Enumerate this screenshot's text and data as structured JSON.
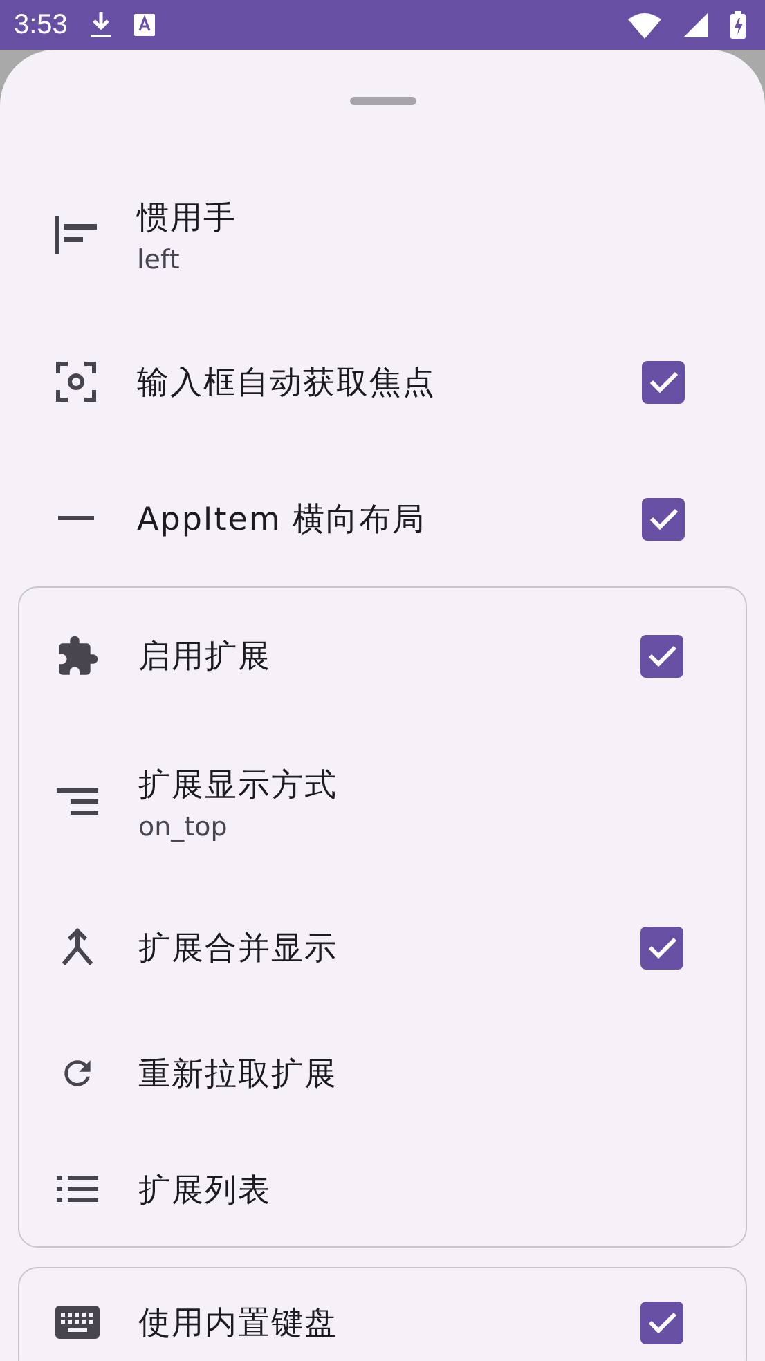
{
  "status_bar": {
    "time": "3:53"
  },
  "sections": [
    {
      "boxed": false,
      "items": [
        {
          "kind": "value",
          "title": "惯用手",
          "value": "left"
        },
        {
          "kind": "checkbox",
          "title": "输入框自动获取焦点",
          "checked": true
        },
        {
          "kind": "checkbox",
          "title": "AppItem 横向布局",
          "checked": true
        }
      ]
    },
    {
      "boxed": true,
      "items": [
        {
          "kind": "checkbox",
          "title": "启用扩展",
          "checked": true
        },
        {
          "kind": "value",
          "title": "扩展显示方式",
          "value": "on_top"
        },
        {
          "kind": "checkbox",
          "title": "扩展合并显示",
          "checked": true
        },
        {
          "kind": "action",
          "title": "重新拉取扩展"
        },
        {
          "kind": "action",
          "title": "扩展列表"
        }
      ]
    },
    {
      "boxed": true,
      "items": [
        {
          "kind": "checkbox",
          "title": "使用内置键盘",
          "checked": true
        }
      ]
    }
  ]
}
